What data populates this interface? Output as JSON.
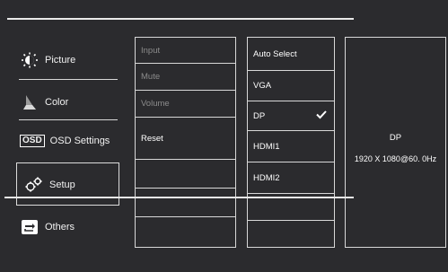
{
  "sidebar": {
    "items": [
      {
        "label": "Picture",
        "icon": "picture-icon"
      },
      {
        "label": "Color",
        "icon": "color-icon"
      },
      {
        "label": "OSD Settings",
        "icon": "osd-icon",
        "icon_text": "OSD"
      },
      {
        "label": "Setup",
        "icon": "setup-icon"
      },
      {
        "label": "Others",
        "icon": "others-icon"
      }
    ]
  },
  "menu": {
    "items": [
      {
        "label": "Input",
        "disabled": true
      },
      {
        "label": "Mute",
        "disabled": true
      },
      {
        "label": "Volume",
        "disabled": true
      },
      {
        "label": "Reset",
        "disabled": false
      },
      {
        "label": ""
      },
      {
        "label": ""
      },
      {
        "label": ""
      },
      {
        "label": ""
      }
    ]
  },
  "submenu": {
    "items": [
      {
        "label": "Auto Select"
      },
      {
        "label": "VGA"
      },
      {
        "label": "DP",
        "checked": true
      },
      {
        "label": "HDMI1"
      },
      {
        "label": "HDMI2"
      },
      {
        "label": ""
      },
      {
        "label": ""
      }
    ]
  },
  "info": {
    "source": "DP",
    "resolution": "1920 X 1080@60. 0Hz"
  },
  "colors": {
    "background": "#2b2b2e",
    "line": "#d8d8d8",
    "text": "#ffffff",
    "disabled_text": "#8c8c8c"
  }
}
